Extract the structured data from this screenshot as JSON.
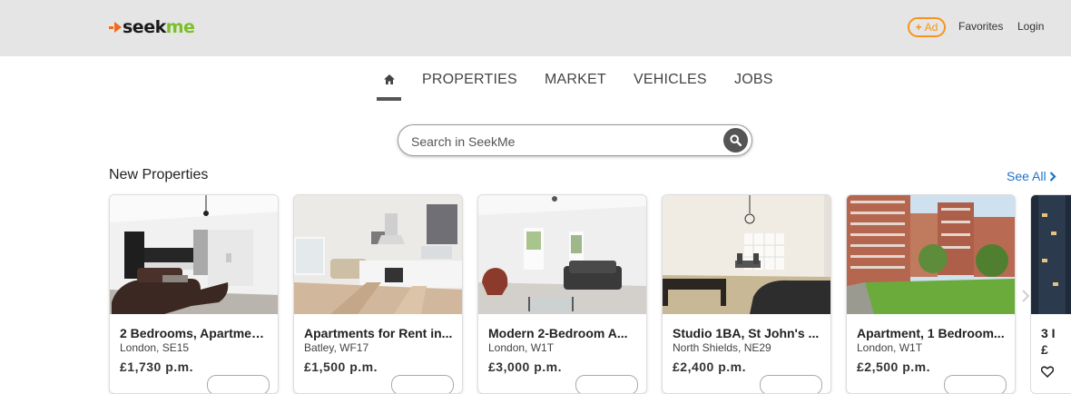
{
  "header": {
    "logo_main": "seek",
    "logo_accent": "me",
    "ad_label": "Ad",
    "favorites": "Favorites",
    "login": "Login"
  },
  "nav": {
    "tabs": [
      "PROPERTIES",
      "MARKET",
      "VEHICLES",
      "JOBS"
    ]
  },
  "search": {
    "placeholder": "Search in SeekMe"
  },
  "section": {
    "title": "New Properties",
    "see_all": "See All"
  },
  "cards": [
    {
      "title": "2 Bedrooms, Apartment...",
      "location": "London, SE15",
      "price": "£1,730 p.m."
    },
    {
      "title": "Apartments for Rent in...",
      "location": "Batley, WF17",
      "price": "£1,500 p.m."
    },
    {
      "title": "Modern 2-Bedroom A...",
      "location": "London, W1T",
      "price": "£3,000 p.m."
    },
    {
      "title": "Studio 1BA, St John's ...",
      "location": "North Shields, NE29",
      "price": "£2,400 p.m."
    },
    {
      "title": "Apartment, 1 Bedroom...",
      "location": "London, W1T",
      "price": "£2,500 p.m."
    },
    {
      "title": "3 I",
      "location": "",
      "price": "£"
    }
  ],
  "colors": {
    "brand_orange": "#f36b1c",
    "brand_green": "#7bbf2a",
    "link_blue": "#1f73c9",
    "ad_orange": "#f7931e"
  }
}
